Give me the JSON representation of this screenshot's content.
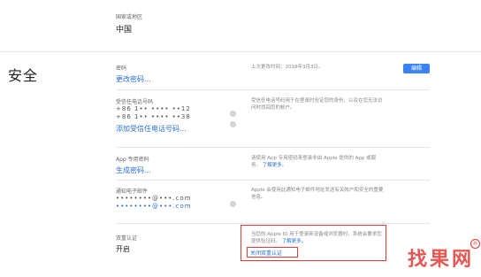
{
  "region": {
    "label": "国家或地区",
    "value": "中国"
  },
  "section": {
    "title": "安全"
  },
  "password": {
    "label": "密码",
    "link": "更改密码…",
    "desc": "上次更改时间：2018年3月3日。",
    "button": "编辑"
  },
  "trusted_phone": {
    "label": "受信任电话号码",
    "masked_lines": [
      "+86 1•• •••• ••12",
      "+86 1•• •••• ••38"
    ],
    "link": "添加受信任电话号码…",
    "desc": "受信任电话号码用于在登录时验证您的身份，以及在您无法访问时找回您的帐户。"
  },
  "app_password": {
    "label": "App 专用密码",
    "link": "生成密码…",
    "desc": "请使用 App 专用密码来登录非由 Apple 提供的 App 或服务。",
    "learn_more": "了解更多。"
  },
  "notify_email": {
    "label": "通知电子邮件",
    "masked_lines": [
      "••••••••@•••.com",
      "••••••••@•••.com"
    ],
    "desc": "Apple 会使用此通知电子邮件地址发送有关帐户和安全的重要信息。"
  },
  "two_factor": {
    "label": "双重认证",
    "value": "开启",
    "desc": "当您的 Apple ID 用于登录新设备或浏览器时，系统会要求您提供验证码。",
    "learn_more": "了解更多。",
    "turn_off": "关闭双重认证"
  },
  "watermark": {
    "text": "找果网"
  }
}
